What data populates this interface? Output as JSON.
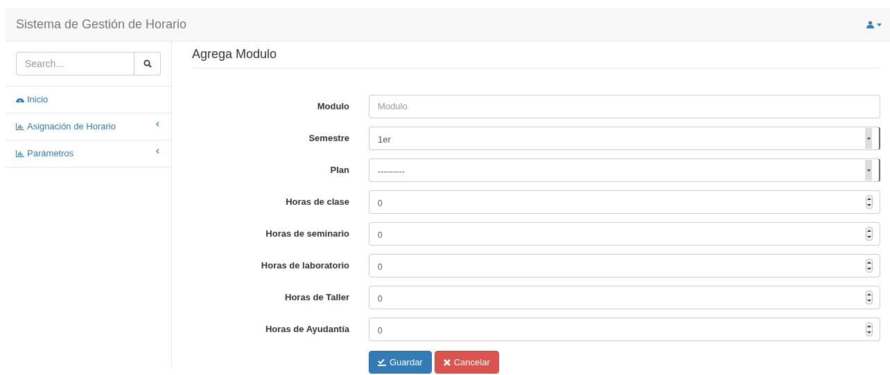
{
  "navbar": {
    "brand": "Sistema de Gestión de Horario"
  },
  "sidebar": {
    "search": {
      "placeholder": "Search..."
    },
    "items": [
      {
        "label": "Inicio",
        "kind": "gauge",
        "expandable": false
      },
      {
        "label": "Asignación de Horario",
        "kind": "chart",
        "expandable": true
      },
      {
        "label": "Parámetros",
        "kind": "chart",
        "expandable": true
      }
    ]
  },
  "form": {
    "title": "Agrega Modulo",
    "fields": [
      {
        "label": "Modulo",
        "kind": "text",
        "placeholder": "Modulo"
      },
      {
        "label": "Semestre",
        "kind": "select",
        "value": "1er"
      },
      {
        "label": "Plan",
        "kind": "select",
        "value": "---------"
      },
      {
        "label": "Horas de clase",
        "kind": "number",
        "value": "0"
      },
      {
        "label": "Horas de seminario",
        "kind": "number",
        "value": "0"
      },
      {
        "label": "Horas de laboratorio",
        "kind": "number",
        "value": "0"
      },
      {
        "label": "Horas de Taller",
        "kind": "number",
        "value": "0"
      },
      {
        "label": "Horas de Ayudantía",
        "kind": "number",
        "value": "0"
      }
    ],
    "buttons": [
      {
        "label": "Guardar",
        "kind": "primary"
      },
      {
        "label": "Cancelar",
        "kind": "danger"
      }
    ]
  }
}
